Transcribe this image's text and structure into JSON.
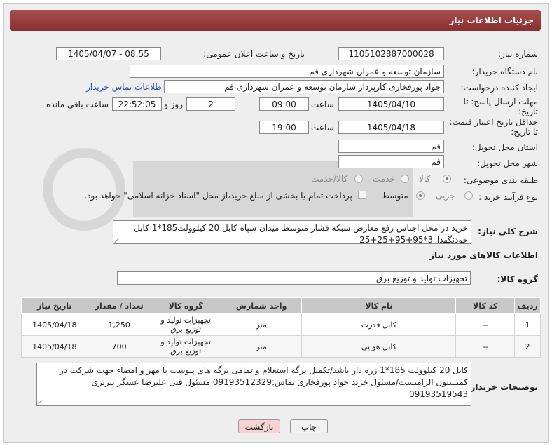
{
  "header": {
    "title": "جزئیات اطلاعات نیاز"
  },
  "form": {
    "need_number_label": "شماره نیاز:",
    "need_number": "1105102887000028",
    "announce_label": "تاریخ و ساعت اعلان عمومی:",
    "announce_value": "1405/04/07 - 08:55",
    "buyer_org_label": "نام دستگاه خریدار:",
    "buyer_org": "سازمان توسعه و عمران شهرداری قم",
    "requester_label": "ایجاد کننده درخواست:",
    "requester": "جواد پورفخاری کارپرداز سازمان توسعه و عمران شهرداری قم",
    "buyer_contact_link": "اطلاعات تماس خریدار",
    "deadline_label_1": "مهلت ارسال پاسخ: تا",
    "deadline_label_2": "تاریخ:",
    "deadline_date": "1405/04/10",
    "time_label": "ساعت",
    "deadline_time": "09:00",
    "days_value": "2",
    "days_label": "روز و",
    "remaining_value": "22:52:05",
    "remaining_label": "ساعت باقی مانده",
    "price_validity_label_1": "حداقل تاریخ اعتبار قیمت:",
    "price_validity_label_2": "تا تاریخ:",
    "price_validity_date": "1405/04/18",
    "price_validity_time": "19:00",
    "province_label": "استان محل تحویل:",
    "province": "قم",
    "city_label": "شهر محل تحویل:",
    "city": "قم",
    "category_label": "طبقه بندی موضوعی:",
    "category_options": [
      "کالا",
      "خدمت",
      "کالا/خدمت"
    ],
    "process_label": "نوع فرآیند خرید :",
    "process_options": [
      "جزیی",
      "متوسط"
    ],
    "payment_note": "پرداخت تمام یا بخشی از مبلغ خرید،از محل \"اسناد خزانه اسلامی\" خواهد بود.",
    "description_label": "شرح کلی نیاز:",
    "description": "خرید در محل اجناس رفع معارض شبکه فشار متوسط میدان سپاه کابل 20 کیلوولت185*1 کابل خودنگهدار3*95+95+25+25",
    "goods_info_title": "اطلاعات کالاهای مورد نیاز",
    "goods_group_label": "گروه کالا:",
    "goods_group": "تجهیزات تولید و توزیع برق",
    "buyer_notes_label": "توضیحات خریدار:",
    "buyer_notes": "کابل 20 کیلوولت 185*1 زره دار باشد/تکمیل برگه استعلام و تمامی برگه های پیوست با مهر و امضاء جهت شرکت در کمیسیون الزامیست/مسئول خرید جواد پورفخاری تماس:09193512329 مسئول فنی علیرضا عسگر تبریزی 09193519543"
  },
  "table": {
    "headers": [
      "ردیف",
      "کد کالا",
      "نام کالا",
      "واحد شمارش",
      "گروه کالا",
      "تعداد / مقدار",
      "تاریخ نیاز"
    ],
    "rows": [
      [
        "1",
        "--",
        "کابل قدرت",
        "متر",
        "تجهیزات تولید و توزیع برق",
        "1,250",
        "1405/04/18"
      ],
      [
        "2",
        "--",
        "کابل هوایی",
        "متر",
        "تجهیزات تولید و توزیع برق",
        "700",
        "1405/04/18"
      ]
    ]
  },
  "buttons": {
    "print": "چاپ",
    "back": "بازگشت"
  },
  "icons": {
    "watermark": "ariatender-logo"
  },
  "colors": {
    "header": "#8a2e2e",
    "link": "#2a4fa8",
    "back_button": "#f6d2d2"
  }
}
